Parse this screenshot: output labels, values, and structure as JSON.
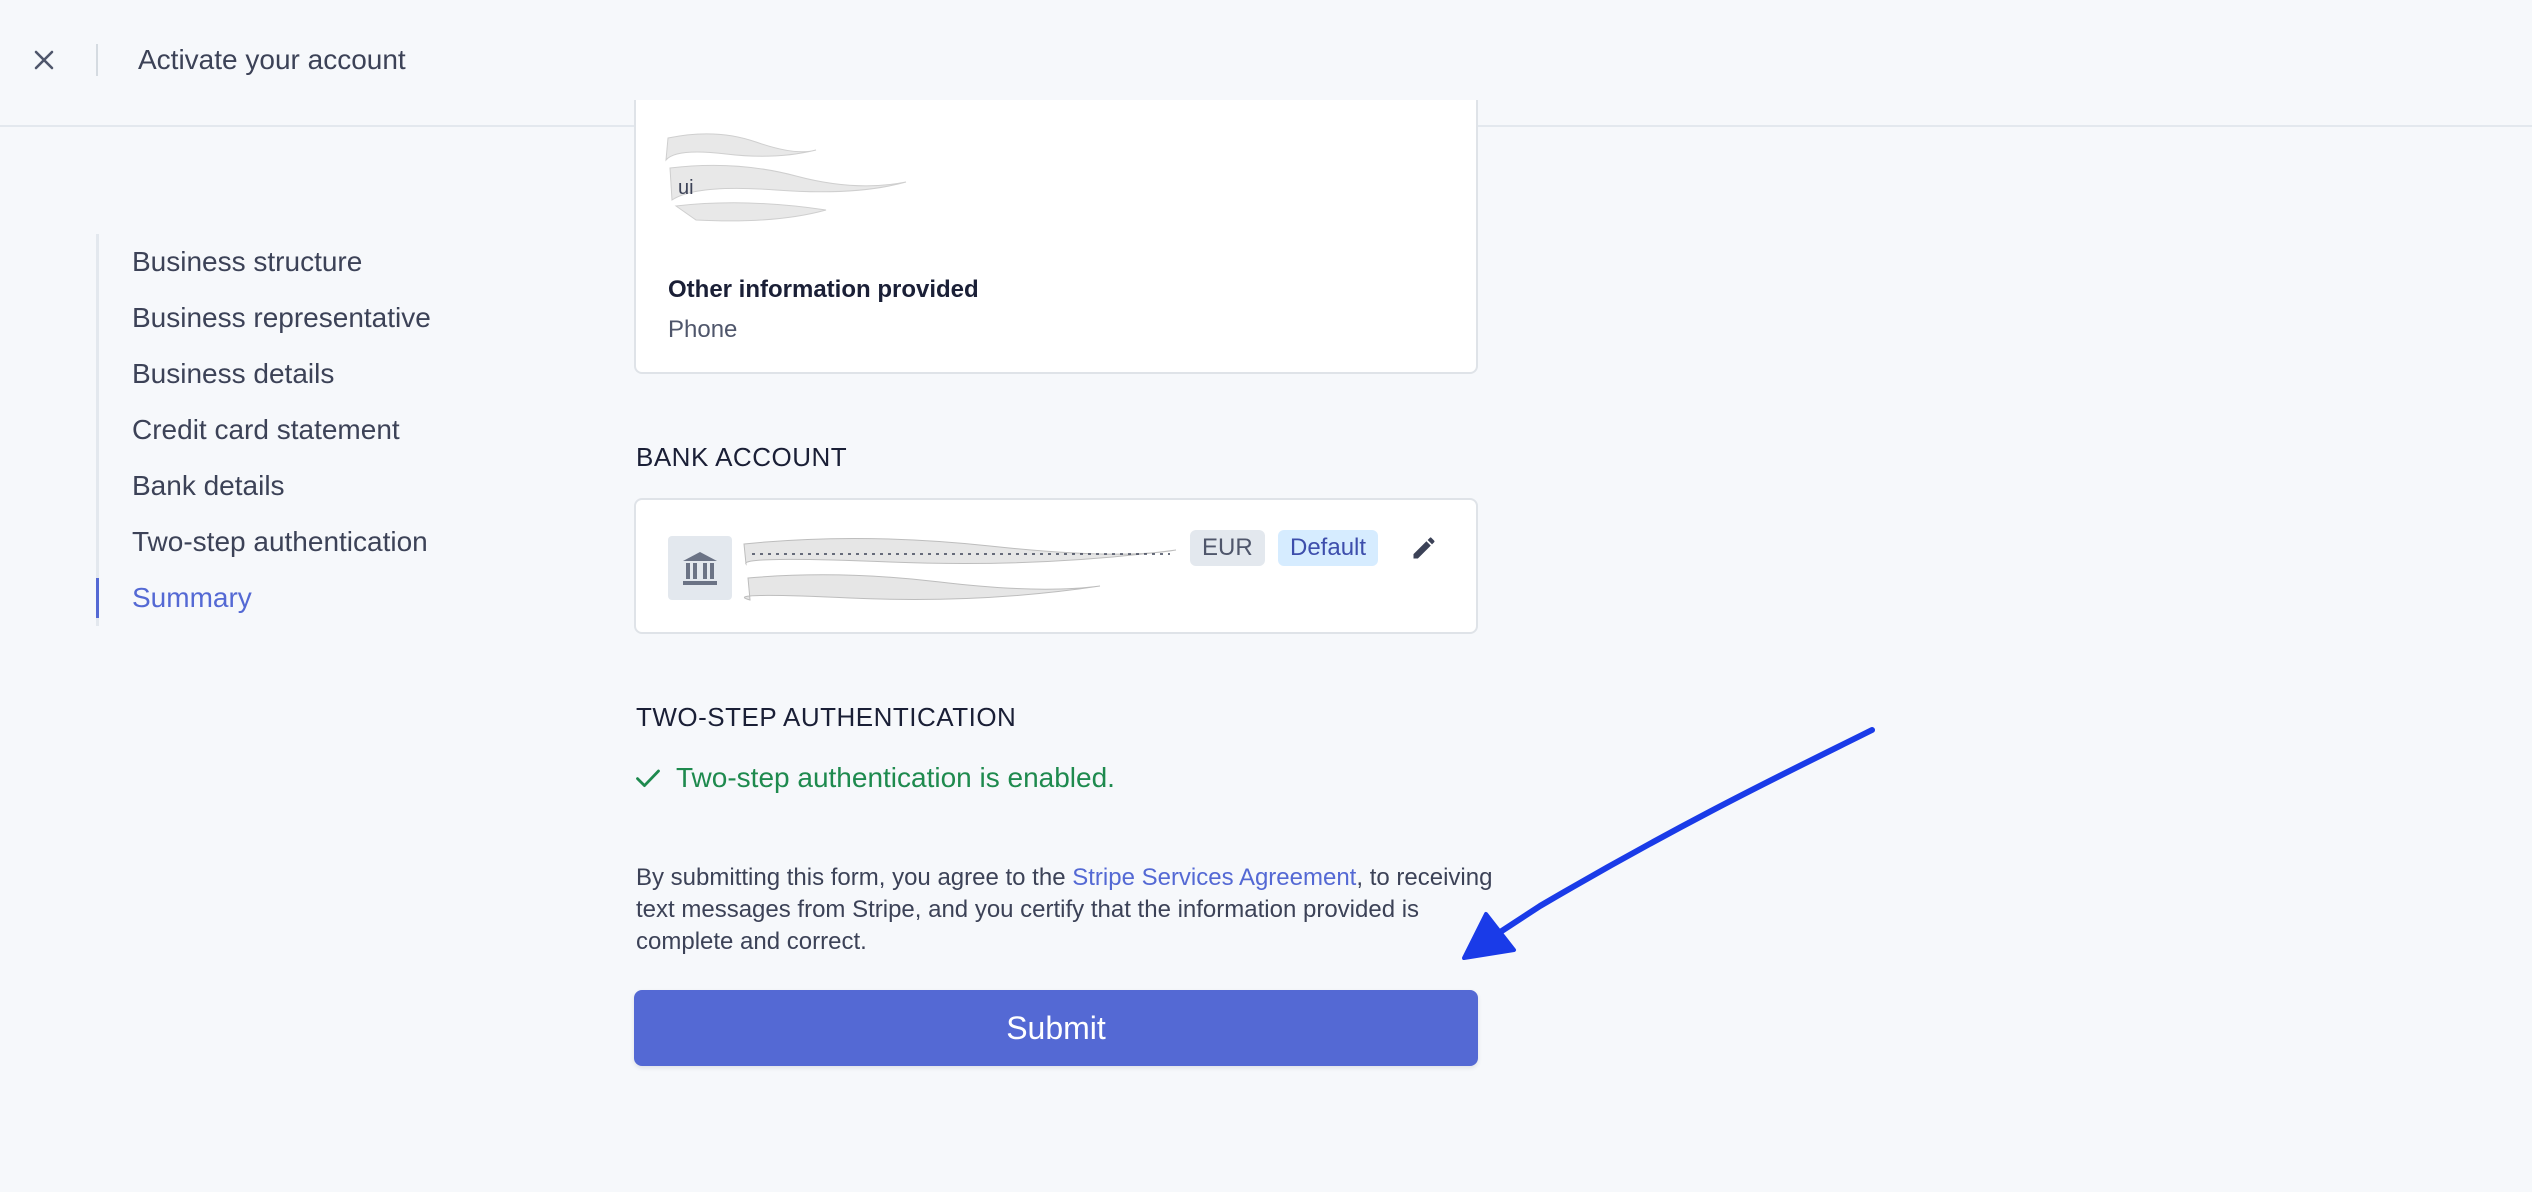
{
  "header": {
    "title": "Activate your account",
    "close_icon": "close-icon"
  },
  "sidebar": {
    "items": [
      {
        "label": "Business structure",
        "active": false
      },
      {
        "label": "Business representative",
        "active": false
      },
      {
        "label": "Business details",
        "active": false
      },
      {
        "label": "Credit card statement",
        "active": false
      },
      {
        "label": "Bank details",
        "active": false
      },
      {
        "label": "Two-step authentication",
        "active": false
      },
      {
        "label": "Summary",
        "active": true
      }
    ]
  },
  "other_info": {
    "label": "Other information provided",
    "value": "Phone"
  },
  "bank_account": {
    "heading": "BANK ACCOUNT",
    "currency": "EUR",
    "default_badge": "Default",
    "icon": "bank-icon",
    "edit_icon": "pencil-icon"
  },
  "two_step": {
    "heading": "TWO-STEP AUTHENTICATION",
    "status": "Two-step authentication is enabled.",
    "icon": "checkmark-icon"
  },
  "agreement": {
    "prefix": "By submitting this form, you agree to the ",
    "link": "Stripe Services Agreement",
    "suffix": ", to receiving text messages from Stripe, and you certify that the information provided is complete and correct."
  },
  "submit_label": "Submit",
  "colors": {
    "accent": "#5469d4",
    "success": "#1e8a4e",
    "annotation_arrow": "#1a3be8"
  }
}
